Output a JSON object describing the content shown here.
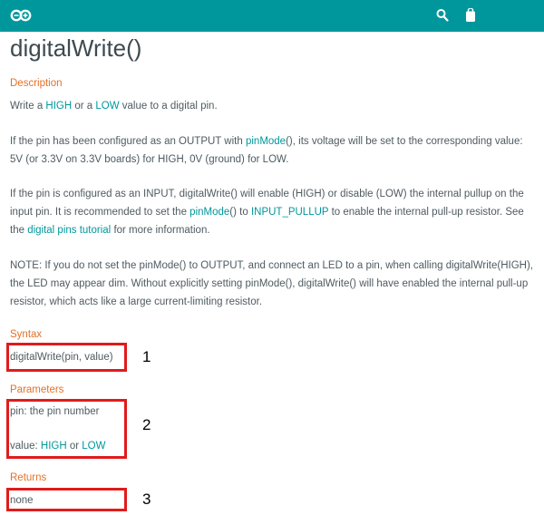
{
  "header": {
    "logo_icon": "infinity-logo-icon",
    "search_icon": "search-icon",
    "cart_icon": "bag-icon",
    "bg_color": "#00979c"
  },
  "title": "digitalWrite()",
  "description": {
    "heading": "Description",
    "p1": {
      "t1": "Write a ",
      "link_high": "HIGH",
      "t2": " or a ",
      "link_low": "LOW",
      "t3": " value to a digital pin."
    },
    "p2": {
      "t1": "If the pin has been configured as an OUTPUT with ",
      "link_pinmode": "pinMode",
      "t2": "(), its voltage will be set to the corresponding value: 5V (or 3.3V on 3.3V boards) for HIGH, 0V (ground) for LOW."
    },
    "p3": {
      "t1": "If the pin is configured as an INPUT, digitalWrite() will enable (HIGH) or disable (LOW) the internal pullup on the input pin. It is recommended to set the ",
      "link_pinmode": "pinMode",
      "t2": "() to ",
      "link_input_pullup": "INPUT_PULLUP",
      "t3": " to enable the internal pull-up resistor. See the ",
      "link_tutorial": "digital pins tutorial",
      "t4": " for more information."
    },
    "p4": "NOTE: If you do not set the pinMode() to OUTPUT, and connect an LED to a pin, when calling digitalWrite(HIGH), the LED may appear dim. Without explicitly setting pinMode(), digitalWrite() will have enabled the internal pull-up resistor, which acts like a large current-limiting resistor."
  },
  "syntax": {
    "heading": "Syntax",
    "code": "digitalWrite(pin, value)",
    "marker": "1"
  },
  "parameters": {
    "heading": "Parameters",
    "pin": "pin: the pin number",
    "value_prefix": "value: ",
    "link_high": "HIGH",
    "or": " or ",
    "link_low": "LOW",
    "marker": "2"
  },
  "returns": {
    "heading": "Returns",
    "value": "none",
    "marker": "3"
  }
}
